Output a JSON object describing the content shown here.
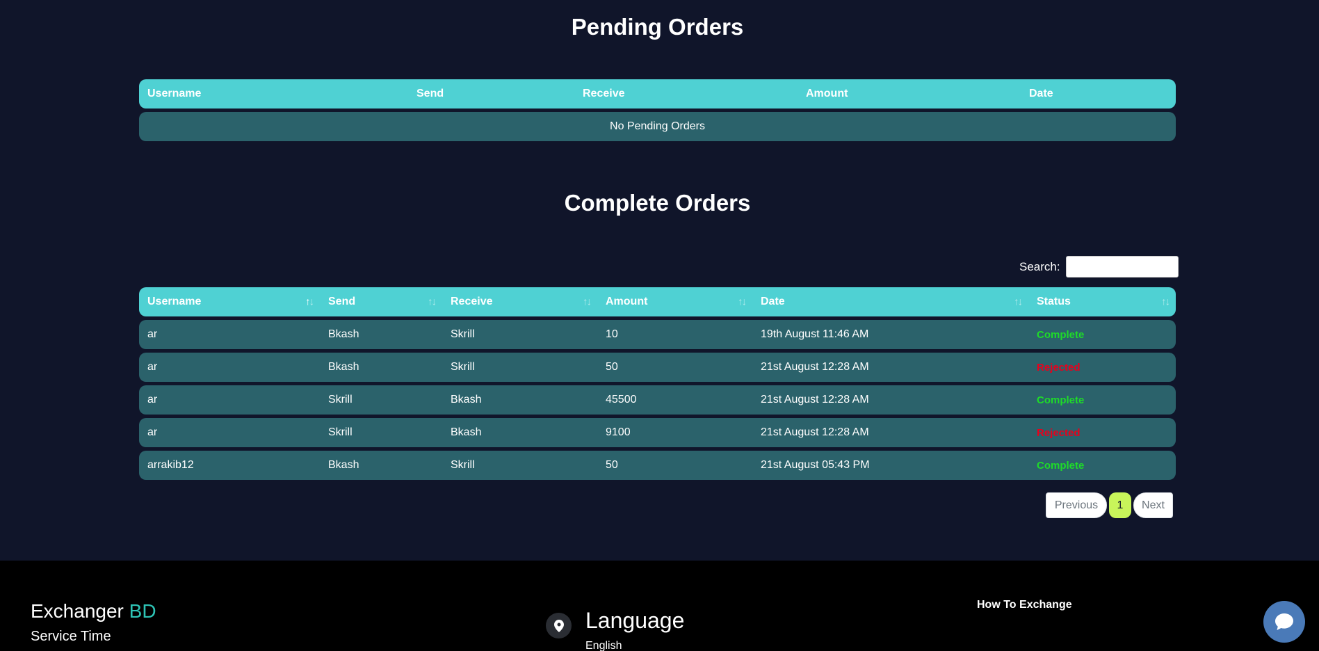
{
  "pending": {
    "title": "Pending Orders",
    "columns": [
      "Username",
      "Send",
      "Receive",
      "Amount",
      "Date"
    ],
    "empty_message": "No Pending Orders"
  },
  "complete": {
    "title": "Complete Orders",
    "search_label": "Search:",
    "search_value": "",
    "columns": [
      "Username",
      "Send",
      "Receive",
      "Amount",
      "Date",
      "Status"
    ],
    "rows": [
      {
        "username": "ar",
        "send": "Bkash",
        "receive": "Skrill",
        "amount": "10",
        "date": "19th August 11:46 AM",
        "status": "Complete"
      },
      {
        "username": "ar",
        "send": "Bkash",
        "receive": "Skrill",
        "amount": "50",
        "date": "21st August 12:28 AM",
        "status": "Rejected"
      },
      {
        "username": "ar",
        "send": "Skrill",
        "receive": "Bkash",
        "amount": "45500",
        "date": "21st August 12:28 AM",
        "status": "Complete"
      },
      {
        "username": "ar",
        "send": "Skrill",
        "receive": "Bkash",
        "amount": "9100",
        "date": "21st August 12:28 AM",
        "status": "Rejected"
      },
      {
        "username": "arrakib12",
        "send": "Bkash",
        "receive": "Skrill",
        "amount": "50",
        "date": "21st August 05:43 PM",
        "status": "Complete"
      }
    ],
    "pagination": {
      "previous": "Previous",
      "current": "1",
      "next": "Next"
    }
  },
  "footer": {
    "brand_main": "Exchanger",
    "brand_accent": "BD",
    "service_time": "Service Time",
    "language_title": "Language",
    "language_value": "English",
    "how_to": "How To Exchange",
    "location_icon": "map-pin-icon",
    "chat_icon": "chat-bubble-icon"
  },
  "colors": {
    "background": "#10152a",
    "header": "#4fd1d3",
    "row": "#2b626b",
    "complete": "#1edc28",
    "rejected": "#e8001c",
    "page_active": "#c8f55a",
    "brand_accent": "#2ec4b6"
  }
}
